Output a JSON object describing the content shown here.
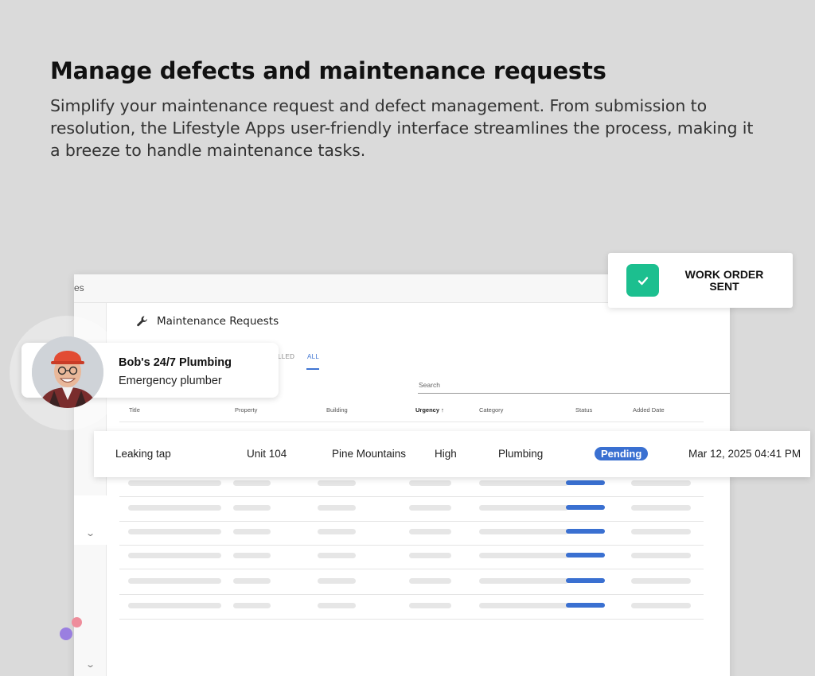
{
  "hero": {
    "title": "Manage defects and maintenance requests",
    "subtitle": "Simplify your maintenance request and defect management. From submission to resolution, the Lifestyle Apps user-friendly interface streamlines the process, making it a breeze to handle maintenance tasks."
  },
  "app": {
    "topbar_text": "es",
    "page_title": "Maintenance Requests",
    "icon": "wrench-icon",
    "tabs": [
      {
        "label": "LLED",
        "active": false
      },
      {
        "label": "ALL",
        "active": true
      }
    ],
    "search_placeholder": "Search",
    "columns": {
      "title": "Title",
      "property": "Property",
      "building": "Building",
      "urgency": "Urgency ↑",
      "category": "Category",
      "status": "Status",
      "added_date": "Added Date"
    }
  },
  "highlight_row": {
    "title": "Leaking tap",
    "property": "Unit 104",
    "building": "Pine Mountains",
    "urgency": "High",
    "category": "Plumbing",
    "status": "Pending",
    "added_date": "Mar 12, 2025 04:41 PM"
  },
  "contact": {
    "name": "Bob's 24/7 Plumbing",
    "role": "Emergency plumber"
  },
  "work_order": {
    "label": "WORK ORDER\nSENT",
    "icon": "check-icon"
  },
  "colors": {
    "accent_blue": "#3a70d1",
    "success_green": "#1cbf8f",
    "background": "#dadada"
  }
}
